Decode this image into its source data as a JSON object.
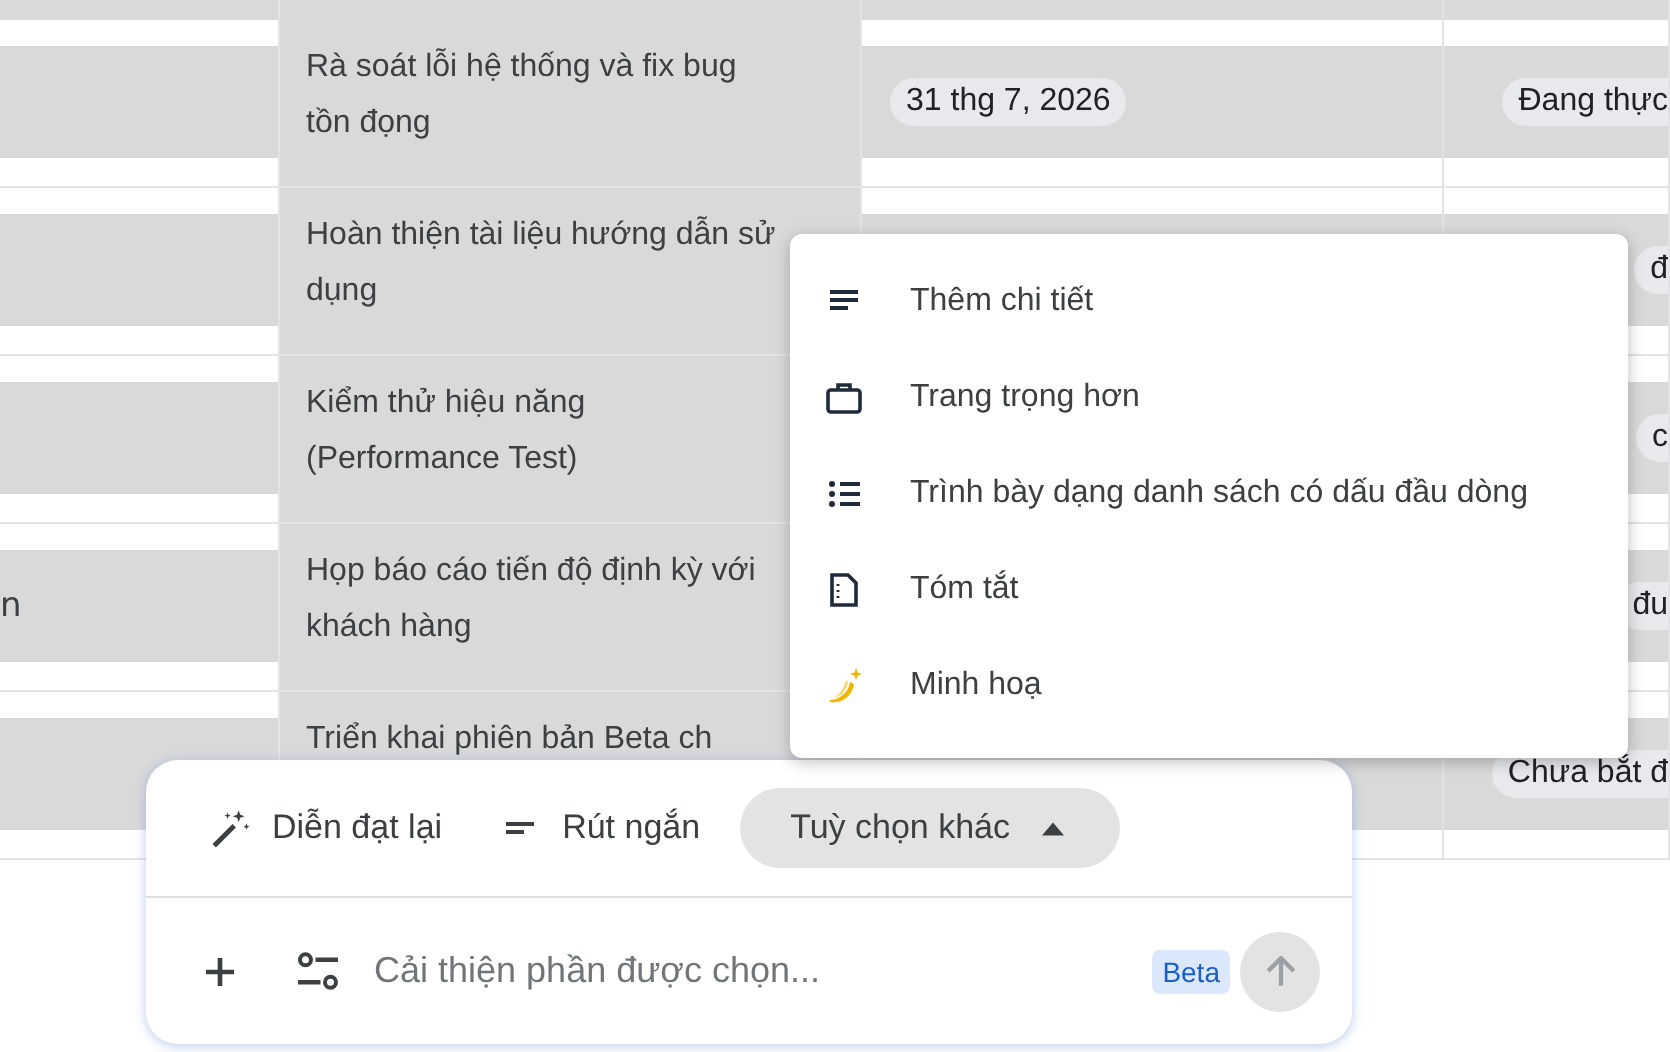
{
  "table": {
    "rows": [
      {
        "task": "Rà soát lỗi hệ thống và fix bug tồn đọng",
        "date": "31 thg 7, 2026",
        "status": "Đang thực"
      },
      {
        "task": "Hoàn thiện tài liệu hướng dẫn sử dụng",
        "status": "đ"
      },
      {
        "task": "Kiểm thử hiệu năng (Performance Test)",
        "status": "c"
      },
      {
        "column_1": "n",
        "task": "Họp báo cáo tiến độ định kỳ với khách hàng",
        "status": "đu"
      },
      {
        "task": "Triển khai phiên bản Beta ch",
        "status": "Chưa bắt đ"
      }
    ]
  },
  "menu": {
    "items": [
      {
        "kind": "lines",
        "label": "Thêm chi tiết"
      },
      {
        "kind": "briefcase",
        "label": "Trang trọng hơn"
      },
      {
        "kind": "bullets",
        "label": "Trình bày dạng danh sách có dấu đầu dòng"
      },
      {
        "kind": "summary",
        "label": "Tóm tắt"
      },
      {
        "kind": "illustrate",
        "label": "Minh hoạ"
      }
    ]
  },
  "assistant": {
    "actions": [
      {
        "kind": "rewrite",
        "label": "Diễn đạt lại"
      },
      {
        "kind": "shorten",
        "label": "Rút ngắn"
      }
    ],
    "more": {
      "label": "Tuỳ chọn khác",
      "expanded": true
    },
    "input": {
      "placeholder": "Cải thiện phần được chọn..."
    },
    "badge": "Beta",
    "send": {
      "disabled": true
    }
  }
}
